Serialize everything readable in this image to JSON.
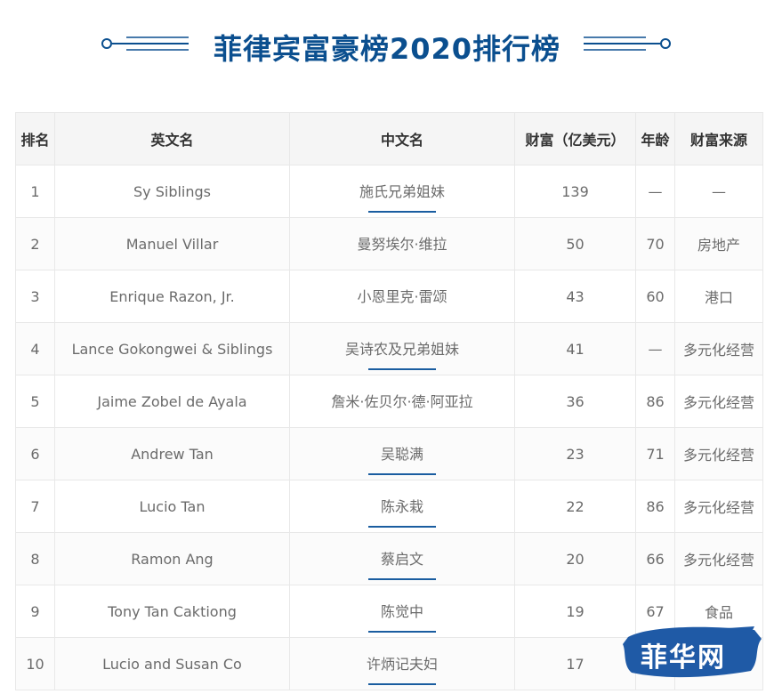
{
  "title": "菲律宾富豪榜2020排行榜",
  "table": {
    "headers": [
      "排名",
      "英文名",
      "中文名",
      "财富（亿美元）",
      "年龄",
      "财富来源"
    ],
    "rows": [
      {
        "rank": "1",
        "en": "Sy Siblings",
        "cn": "施氏兄弟姐妹",
        "wealth": "139",
        "age": "—",
        "source": "—"
      },
      {
        "rank": "2",
        "en": "Manuel Villar",
        "cn": "曼努埃尔·维拉",
        "wealth": "50",
        "age": "70",
        "source": "房地产"
      },
      {
        "rank": "3",
        "en": "Enrique Razon, Jr.",
        "cn": "小恩里克·雷颂",
        "wealth": "43",
        "age": "60",
        "source": "港口"
      },
      {
        "rank": "4",
        "en": "Lance Gokongwei & Siblings",
        "cn": "吴诗农及兄弟姐妹",
        "wealth": "41",
        "age": "—",
        "source": "多元化经营"
      },
      {
        "rank": "5",
        "en": "Jaime Zobel de Ayala",
        "cn": "詹米·佐贝尔·德·阿亚拉",
        "wealth": "36",
        "age": "86",
        "source": "多元化经营"
      },
      {
        "rank": "6",
        "en": "Andrew Tan",
        "cn": "吴聪满",
        "wealth": "23",
        "age": "71",
        "source": "多元化经营"
      },
      {
        "rank": "7",
        "en": "Lucio Tan",
        "cn": "陈永栽",
        "wealth": "22",
        "age": "86",
        "source": "多元化经营"
      },
      {
        "rank": "8",
        "en": "Ramon Ang",
        "cn": "蔡启文",
        "wealth": "20",
        "age": "66",
        "source": "多元化经营"
      },
      {
        "rank": "9",
        "en": "Tony Tan Caktiong",
        "cn": "陈觉中",
        "wealth": "19",
        "age": "67",
        "source": "食品"
      },
      {
        "rank": "10",
        "en": "Lucio and Susan Co",
        "cn": "许炳记夫妇",
        "wealth": "17",
        "age": "",
        "source": ""
      }
    ],
    "underlined_rows": [
      0,
      3,
      5,
      6,
      7,
      8,
      9
    ]
  },
  "watermark": {
    "text": "菲华网",
    "color": "#1f5aa6"
  },
  "colors": {
    "title": "#0b4f8f",
    "accent_line": "#1a5da0",
    "header_bg": "#f5f5f5",
    "border": "#e8e8e8"
  }
}
